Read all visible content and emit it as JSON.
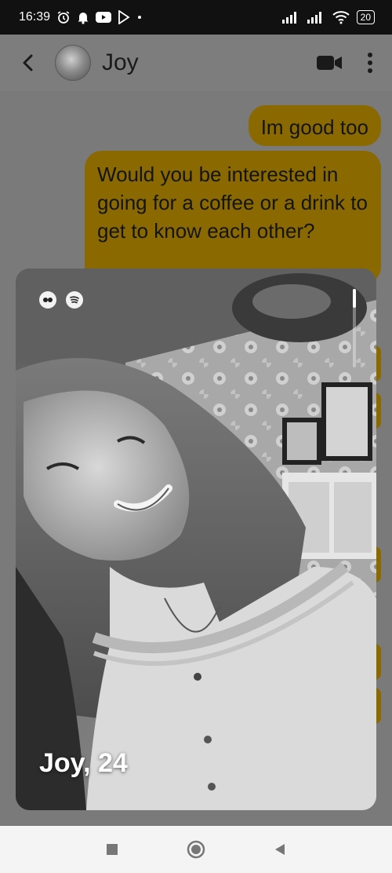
{
  "status_bar": {
    "time": "16:39",
    "battery": "20",
    "icons": [
      "alarm-icon",
      "notification-bell-icon",
      "youtube-icon",
      "play-store-icon",
      "signal-icon",
      "wifi-icon"
    ]
  },
  "header": {
    "contact_name": "Joy",
    "icons": [
      "back-arrow-icon",
      "video-call-icon",
      "more-vert-icon"
    ]
  },
  "messages": [
    {
      "from": "me",
      "text": "Im good too"
    },
    {
      "from": "me",
      "text": "Would you be interested in going for a coffee or a drink to get to know each other?"
    }
  ],
  "profile_card": {
    "name_age": "Joy, 24",
    "badges": [
      "music-icon",
      "spotify-icon"
    ]
  },
  "colors": {
    "bubble": "#8a6a00",
    "overlay": "#7a7a7a",
    "statusbar": "#111111"
  },
  "nav": [
    "recents-square-icon",
    "home-circle-icon",
    "back-triangle-icon"
  ]
}
